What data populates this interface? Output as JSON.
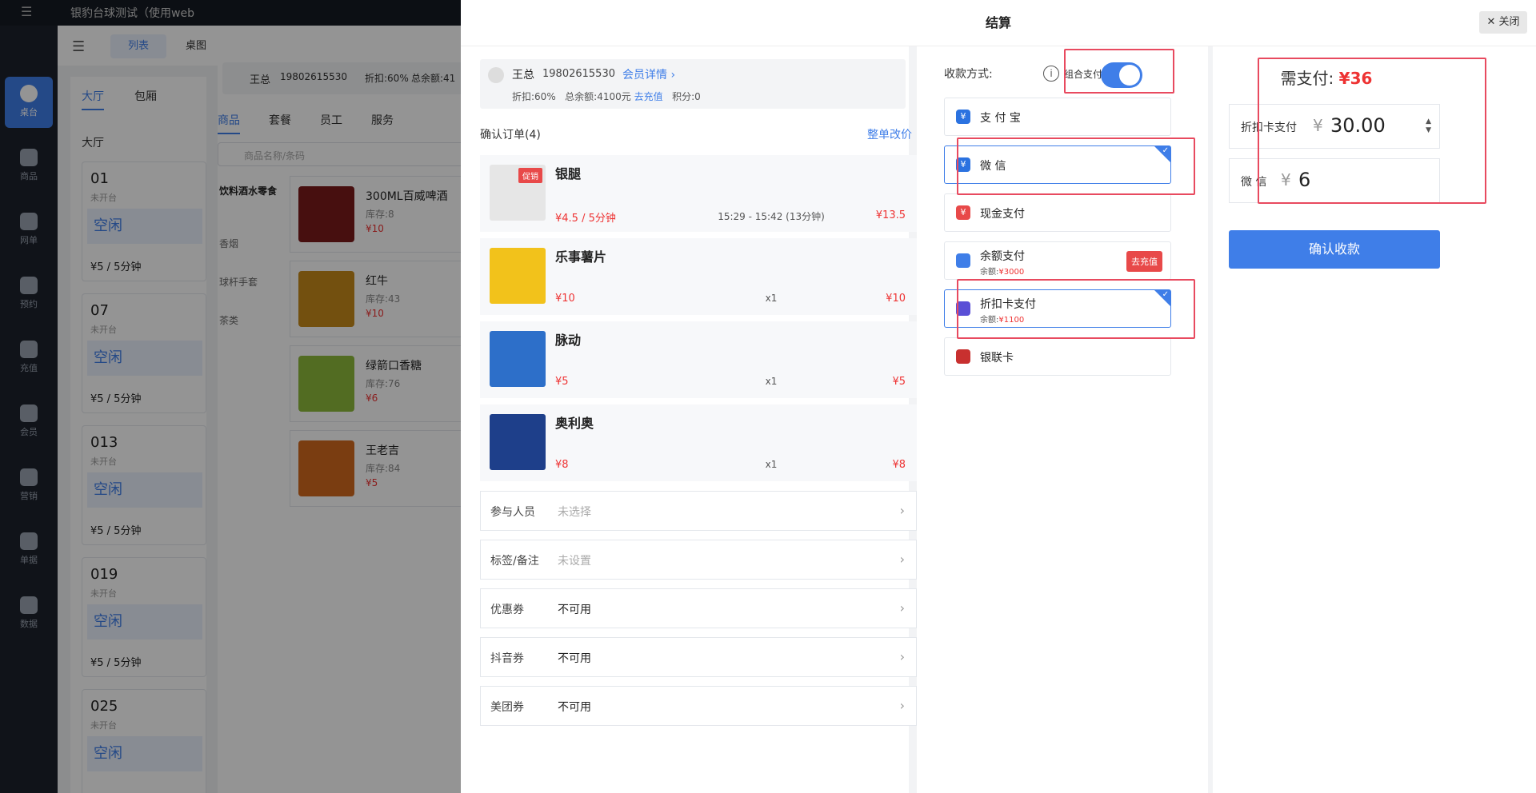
{
  "topbar": {
    "menu_icon": "menu-icon",
    "tab_title": "银豹台球测试（使用web"
  },
  "sidenav": [
    {
      "label": "桌台",
      "icon": "table-icon",
      "active": true
    },
    {
      "label": "商品",
      "icon": "goods-icon"
    },
    {
      "label": "网单",
      "icon": "online-order-icon"
    },
    {
      "label": "预约",
      "icon": "reservation-icon"
    },
    {
      "label": "充值",
      "icon": "recharge-icon"
    },
    {
      "label": "会员",
      "icon": "member-icon"
    },
    {
      "label": "营销",
      "icon": "marketing-icon"
    },
    {
      "label": "单据",
      "icon": "document-icon"
    },
    {
      "label": "数据",
      "icon": "data-icon"
    }
  ],
  "subbar": {
    "seg_list": "列表",
    "seg_table": "桌图"
  },
  "hall": {
    "tab_hall": "大厅",
    "tab_private": "包厢",
    "section": "大厅",
    "tables": [
      {
        "no": "01",
        "status": "未开台",
        "state": "空闲",
        "price": "¥5 / 5分钟"
      },
      {
        "no": "07",
        "status": "未开台",
        "state": "空闲",
        "price": "¥5 / 5分钟"
      },
      {
        "no": "013",
        "status": "未开台",
        "state": "空闲",
        "price": "¥5 / 5分钟"
      },
      {
        "no": "019",
        "status": "未开台",
        "state": "空闲",
        "price": "¥5 / 5分钟"
      },
      {
        "no": "025",
        "status": "未开台",
        "state": "空闲",
        "price": ""
      }
    ]
  },
  "order_bg": {
    "customer": {
      "name": "王总",
      "phone": "19802615530",
      "discount": "折扣:60%",
      "balance": "总余额:41"
    },
    "tabs": [
      "商品",
      "套餐",
      "员工",
      "服务"
    ],
    "search_placeholder": "商品名称/条码",
    "categories": [
      "饮料酒水零食",
      "香烟",
      "球杆手套",
      "茶类"
    ],
    "products": [
      {
        "name": "300ML百威啤酒",
        "stock": "库存:8",
        "price": "¥10",
        "color": "#7a1b1b"
      },
      {
        "name": "红牛",
        "stock": "库存:43",
        "price": "¥10",
        "color": "#c68a1a"
      },
      {
        "name": "绿箭口香糖",
        "stock": "库存:76",
        "price": "¥6",
        "color": "#8dbb3c"
      },
      {
        "name": "王老吉",
        "stock": "库存:84",
        "price": "¥5",
        "color": "#d2691e"
      }
    ]
  },
  "checkout": {
    "title": "结算",
    "close_label": "关闭",
    "member": {
      "name": "王总",
      "phone": "19802615530",
      "detail_link": "会员详情",
      "discount": "折扣:60%",
      "balance": "总余额:4100元",
      "recharge_link": "去充值",
      "points": "积分:0"
    },
    "order_header": "确认订单(4)",
    "adjust_link": "整单改价",
    "items": [
      {
        "name": "银腿",
        "price": "¥4.5 / 5分钟",
        "middle": "15:29 - 15:42 (13分钟)",
        "total": "¥13.5",
        "badge": "促销",
        "color": "#e6e6e6"
      },
      {
        "name": "乐事薯片",
        "price": "¥10",
        "middle": "x1",
        "total": "¥10",
        "badge": "",
        "color": "#f2c21b"
      },
      {
        "name": "脉动",
        "price": "¥5",
        "middle": "x1",
        "total": "¥5",
        "badge": "",
        "color": "#2d6fc9"
      },
      {
        "name": "奥利奥",
        "price": "¥8",
        "middle": "x1",
        "total": "¥8",
        "badge": "",
        "color": "#1e3f8a"
      }
    ],
    "fields": [
      {
        "label": "参与人员",
        "value": "未选择",
        "muted": true
      },
      {
        "label": "标签/备注",
        "value": "未设置",
        "muted": true
      },
      {
        "label": "优惠券",
        "value": "不可用",
        "muted": false
      },
      {
        "label": "抖音券",
        "value": "不可用",
        "muted": false
      },
      {
        "label": "美团券",
        "value": "不可用",
        "muted": false
      }
    ],
    "payment_label": "收款方式:",
    "combo_label": "组合支付",
    "combo_on": true,
    "methods": [
      {
        "label": "支 付 宝",
        "icon": "alipay-icon",
        "color": "#2b72e0",
        "glyph": "¥",
        "selected": false
      },
      {
        "label": "微 信",
        "icon": "wechat-icon",
        "color": "#2b72e0",
        "glyph": "¥",
        "selected": true
      },
      {
        "label": "现金支付",
        "icon": "cash-icon",
        "color": "#e84949",
        "glyph": "¥",
        "selected": false
      },
      {
        "label": "余额支付",
        "icon": "wallet-icon",
        "color": "#3f7ee8",
        "glyph": "",
        "selected": false,
        "sub_label": "余额:",
        "sub_value": "¥3000",
        "action": "去充值"
      },
      {
        "label": "折扣卡支付",
        "icon": "card-icon",
        "color": "#5a4fd6",
        "glyph": "",
        "selected": true,
        "sub_label": "余额:",
        "sub_value": "¥1100"
      },
      {
        "label": "银联卡",
        "icon": "unionpay-icon",
        "color": "#c8302f",
        "glyph": "",
        "selected": false
      }
    ],
    "due_label": "需支付:",
    "due_value": "¥36",
    "amounts": [
      {
        "label": "折扣卡支付",
        "currency": "¥",
        "value": "30.00"
      },
      {
        "label": "微 信",
        "currency": "¥",
        "value": "6"
      }
    ],
    "confirm_label": "确认收款"
  }
}
